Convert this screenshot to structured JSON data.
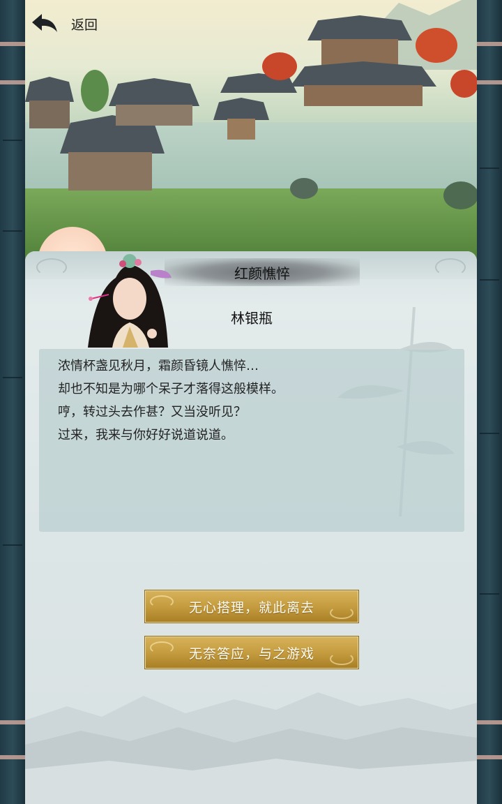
{
  "nav": {
    "back_label": "返回",
    "back_icon": "back-arrow-icon"
  },
  "dialog": {
    "title": "红颜憔悴",
    "speaker": "林银瓶",
    "lines": [
      "浓情杯盏见秋月，霜颜昏镜人憔悴…",
      "却也不知是为哪个呆子才落得这般模样。",
      "哼，转过头去作甚？又当没听见？",
      "过来，我来与你好好说道说道。"
    ]
  },
  "choices": [
    {
      "label": "无心搭理，就此离去"
    },
    {
      "label": "无奈答应，与之游戏"
    }
  ],
  "colors": {
    "button_gold": "#c59c3f",
    "panel_bg": "#dde6e7",
    "side_border": "#2d4c58"
  }
}
